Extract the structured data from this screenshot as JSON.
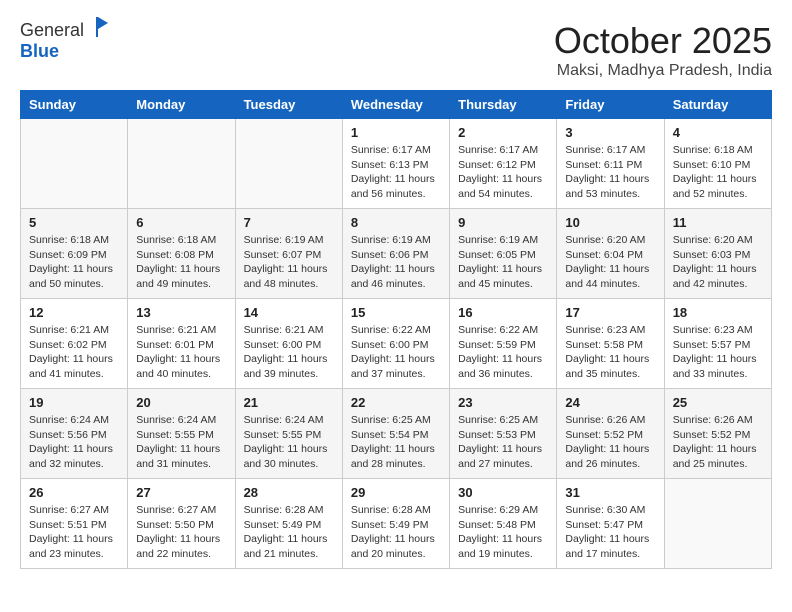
{
  "header": {
    "logo_line1": "General",
    "logo_line2": "Blue",
    "month": "October 2025",
    "location": "Maksi, Madhya Pradesh, India"
  },
  "weekdays": [
    "Sunday",
    "Monday",
    "Tuesday",
    "Wednesday",
    "Thursday",
    "Friday",
    "Saturday"
  ],
  "weeks": [
    [
      {
        "day": "",
        "text": ""
      },
      {
        "day": "",
        "text": ""
      },
      {
        "day": "",
        "text": ""
      },
      {
        "day": "1",
        "text": "Sunrise: 6:17 AM\nSunset: 6:13 PM\nDaylight: 11 hours\nand 56 minutes."
      },
      {
        "day": "2",
        "text": "Sunrise: 6:17 AM\nSunset: 6:12 PM\nDaylight: 11 hours\nand 54 minutes."
      },
      {
        "day": "3",
        "text": "Sunrise: 6:17 AM\nSunset: 6:11 PM\nDaylight: 11 hours\nand 53 minutes."
      },
      {
        "day": "4",
        "text": "Sunrise: 6:18 AM\nSunset: 6:10 PM\nDaylight: 11 hours\nand 52 minutes."
      }
    ],
    [
      {
        "day": "5",
        "text": "Sunrise: 6:18 AM\nSunset: 6:09 PM\nDaylight: 11 hours\nand 50 minutes."
      },
      {
        "day": "6",
        "text": "Sunrise: 6:18 AM\nSunset: 6:08 PM\nDaylight: 11 hours\nand 49 minutes."
      },
      {
        "day": "7",
        "text": "Sunrise: 6:19 AM\nSunset: 6:07 PM\nDaylight: 11 hours\nand 48 minutes."
      },
      {
        "day": "8",
        "text": "Sunrise: 6:19 AM\nSunset: 6:06 PM\nDaylight: 11 hours\nand 46 minutes."
      },
      {
        "day": "9",
        "text": "Sunrise: 6:19 AM\nSunset: 6:05 PM\nDaylight: 11 hours\nand 45 minutes."
      },
      {
        "day": "10",
        "text": "Sunrise: 6:20 AM\nSunset: 6:04 PM\nDaylight: 11 hours\nand 44 minutes."
      },
      {
        "day": "11",
        "text": "Sunrise: 6:20 AM\nSunset: 6:03 PM\nDaylight: 11 hours\nand 42 minutes."
      }
    ],
    [
      {
        "day": "12",
        "text": "Sunrise: 6:21 AM\nSunset: 6:02 PM\nDaylight: 11 hours\nand 41 minutes."
      },
      {
        "day": "13",
        "text": "Sunrise: 6:21 AM\nSunset: 6:01 PM\nDaylight: 11 hours\nand 40 minutes."
      },
      {
        "day": "14",
        "text": "Sunrise: 6:21 AM\nSunset: 6:00 PM\nDaylight: 11 hours\nand 39 minutes."
      },
      {
        "day": "15",
        "text": "Sunrise: 6:22 AM\nSunset: 6:00 PM\nDaylight: 11 hours\nand 37 minutes."
      },
      {
        "day": "16",
        "text": "Sunrise: 6:22 AM\nSunset: 5:59 PM\nDaylight: 11 hours\nand 36 minutes."
      },
      {
        "day": "17",
        "text": "Sunrise: 6:23 AM\nSunset: 5:58 PM\nDaylight: 11 hours\nand 35 minutes."
      },
      {
        "day": "18",
        "text": "Sunrise: 6:23 AM\nSunset: 5:57 PM\nDaylight: 11 hours\nand 33 minutes."
      }
    ],
    [
      {
        "day": "19",
        "text": "Sunrise: 6:24 AM\nSunset: 5:56 PM\nDaylight: 11 hours\nand 32 minutes."
      },
      {
        "day": "20",
        "text": "Sunrise: 6:24 AM\nSunset: 5:55 PM\nDaylight: 11 hours\nand 31 minutes."
      },
      {
        "day": "21",
        "text": "Sunrise: 6:24 AM\nSunset: 5:55 PM\nDaylight: 11 hours\nand 30 minutes."
      },
      {
        "day": "22",
        "text": "Sunrise: 6:25 AM\nSunset: 5:54 PM\nDaylight: 11 hours\nand 28 minutes."
      },
      {
        "day": "23",
        "text": "Sunrise: 6:25 AM\nSunset: 5:53 PM\nDaylight: 11 hours\nand 27 minutes."
      },
      {
        "day": "24",
        "text": "Sunrise: 6:26 AM\nSunset: 5:52 PM\nDaylight: 11 hours\nand 26 minutes."
      },
      {
        "day": "25",
        "text": "Sunrise: 6:26 AM\nSunset: 5:52 PM\nDaylight: 11 hours\nand 25 minutes."
      }
    ],
    [
      {
        "day": "26",
        "text": "Sunrise: 6:27 AM\nSunset: 5:51 PM\nDaylight: 11 hours\nand 23 minutes."
      },
      {
        "day": "27",
        "text": "Sunrise: 6:27 AM\nSunset: 5:50 PM\nDaylight: 11 hours\nand 22 minutes."
      },
      {
        "day": "28",
        "text": "Sunrise: 6:28 AM\nSunset: 5:49 PM\nDaylight: 11 hours\nand 21 minutes."
      },
      {
        "day": "29",
        "text": "Sunrise: 6:28 AM\nSunset: 5:49 PM\nDaylight: 11 hours\nand 20 minutes."
      },
      {
        "day": "30",
        "text": "Sunrise: 6:29 AM\nSunset: 5:48 PM\nDaylight: 11 hours\nand 19 minutes."
      },
      {
        "day": "31",
        "text": "Sunrise: 6:30 AM\nSunset: 5:47 PM\nDaylight: 11 hours\nand 17 minutes."
      },
      {
        "day": "",
        "text": ""
      }
    ]
  ]
}
